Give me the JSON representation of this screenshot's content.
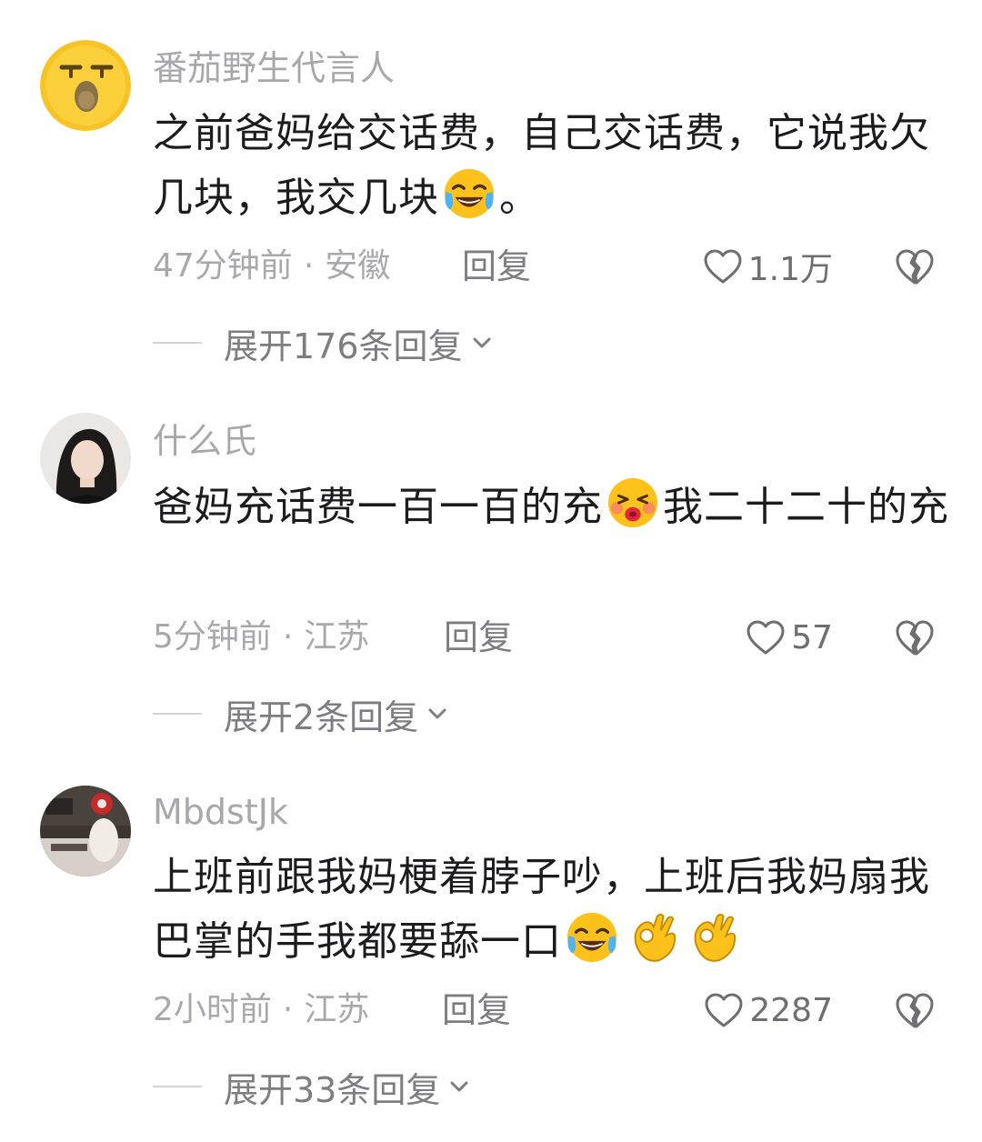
{
  "comments": [
    {
      "username": "番茄野生代言人",
      "avatar_icon": "yawning-emoji-avatar",
      "text_parts": [
        "之前爸妈给交话费，自己交话费，它说我欠几块，我交几块",
        "。"
      ],
      "emoji": [
        "tears-of-joy-emoji"
      ],
      "time": "47分钟前",
      "location": "安徽",
      "reply_label": "回复",
      "likes": "1.1万",
      "expand_label": "展开176条回复"
    },
    {
      "username": "什么氏",
      "avatar_icon": "girl-photo-avatar",
      "text_parts": [
        "爸妈充话费一百一百的充",
        "我二十二十的充"
      ],
      "emoji": [
        "kissing-face-emoji"
      ],
      "time": "5分钟前",
      "location": "江苏",
      "reply_label": "回复",
      "likes": "57",
      "expand_label": "展开2条回复"
    },
    {
      "username": "MbdstJk",
      "avatar_icon": "room-photo-avatar",
      "text_parts": [
        "上班前跟我妈梗着脖子吵，上班后我妈扇我巴掌的手我都要舔一口",
        ""
      ],
      "emoji": [
        "tears-of-joy-emoji",
        "ok-hand-emoji",
        "ok-hand-emoji"
      ],
      "time": "2小时前",
      "location": "江苏",
      "reply_label": "回复",
      "likes": "2287",
      "expand_label": "展开33条回复"
    }
  ],
  "separator": "·",
  "colors": {
    "username": "#a8a8ac",
    "meta": "#a9a9ad",
    "reply": "#7d7d82",
    "text": "#1c1c1e"
  }
}
